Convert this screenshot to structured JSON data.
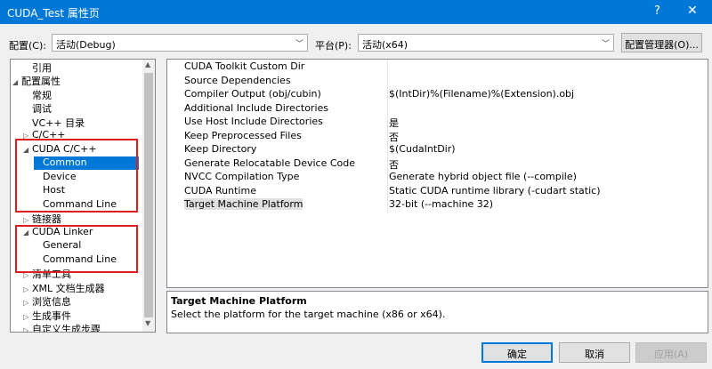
{
  "window": {
    "title": "CUDA_Test 属性页",
    "help_glyph": "?",
    "close_glyph": "✕"
  },
  "toolbar": {
    "config_label": "配置(C):",
    "config_value": "活动(Debug)",
    "platform_label": "平台(P):",
    "platform_value": "活动(x64)",
    "config_manager_label": "配置管理器(O)..."
  },
  "tree": [
    {
      "label": "引用",
      "twisty": ""
    },
    {
      "label": "配置属性",
      "twisty": "◢"
    },
    {
      "label": "常规",
      "twisty": ""
    },
    {
      "label": "调试",
      "twisty": ""
    },
    {
      "label": "VC++ 目录",
      "twisty": ""
    },
    {
      "label": "C/C++",
      "twisty": "▷"
    },
    {
      "label": "CUDA C/C++",
      "twisty": "◢"
    },
    {
      "label": "Common",
      "twisty": "",
      "selected": true
    },
    {
      "label": "Device",
      "twisty": ""
    },
    {
      "label": "Host",
      "twisty": ""
    },
    {
      "label": "Command Line",
      "twisty": ""
    },
    {
      "label": "链接器",
      "twisty": "▷"
    },
    {
      "label": "CUDA Linker",
      "twisty": "◢"
    },
    {
      "label": "General",
      "twisty": ""
    },
    {
      "label": "Command Line",
      "twisty": ""
    },
    {
      "label": "清单工具",
      "twisty": "▷"
    },
    {
      "label": "XML 文档生成器",
      "twisty": "▷"
    },
    {
      "label": "浏览信息",
      "twisty": "▷"
    },
    {
      "label": "生成事件",
      "twisty": "▷"
    },
    {
      "label": "自定义生成步骤",
      "twisty": "▷"
    }
  ],
  "properties": [
    {
      "name": "CUDA Toolkit Custom Dir",
      "value": ""
    },
    {
      "name": "Source Dependencies",
      "value": ""
    },
    {
      "name": "Compiler Output (obj/cubin)",
      "value": "$(IntDir)%(Filename)%(Extension).obj"
    },
    {
      "name": "Additional Include Directories",
      "value": ""
    },
    {
      "name": "Use Host Include Directories",
      "value": "是"
    },
    {
      "name": "Keep Preprocessed Files",
      "value": "否"
    },
    {
      "name": "Keep Directory",
      "value": "$(CudaIntDir)"
    },
    {
      "name": "Generate Relocatable Device Code",
      "value": "否"
    },
    {
      "name": "NVCC Compilation Type",
      "value": "Generate hybrid object file (--compile)"
    },
    {
      "name": "CUDA Runtime",
      "value": "Static CUDA runtime library (-cudart static)"
    },
    {
      "name": "Target Machine Platform",
      "value": "32-bit (--machine 32)",
      "selected": true
    }
  ],
  "description": {
    "title": "Target Machine Platform",
    "text": "Select the platform for the target machine (x86 or x64)."
  },
  "buttons": {
    "ok": "确定",
    "cancel": "取消",
    "apply": "应用(A)"
  },
  "colors": {
    "titlebar": "#0078d7",
    "selection": "#0078d7",
    "highlight_box": "#e01e1e"
  }
}
